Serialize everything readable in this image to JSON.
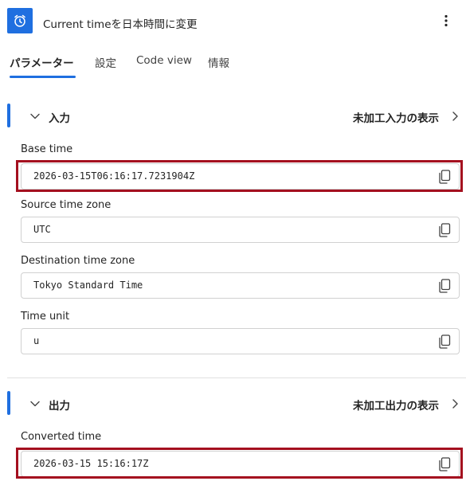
{
  "header": {
    "title": "Current timeを日本時間に変更",
    "icon": "alarm-clock-icon",
    "menu_icon": "more-vertical-icon"
  },
  "tabs": [
    {
      "label": "パラメーター",
      "active": true
    },
    {
      "label": "設定",
      "active": false
    },
    {
      "label": "Code view",
      "active": false
    },
    {
      "label": "情報",
      "active": false
    }
  ],
  "inputs": {
    "section_title": "入力",
    "raw_link": "未加工入力の表示",
    "fields": [
      {
        "label": "Base time",
        "value": "2026-03-15T06:16:17.7231904Z",
        "highlighted": true
      },
      {
        "label": "Source time zone",
        "value": "UTC",
        "highlighted": false
      },
      {
        "label": "Destination time zone",
        "value": "Tokyo Standard Time",
        "highlighted": false
      },
      {
        "label": "Time unit",
        "value": "u",
        "highlighted": false
      }
    ]
  },
  "outputs": {
    "section_title": "出力",
    "raw_link": "未加工出力の表示",
    "fields": [
      {
        "label": "Converted time",
        "value": "2026-03-15 15:16:17Z",
        "highlighted": true
      }
    ]
  },
  "colors": {
    "accent": "#1f6fe0",
    "highlight": "#a4101f",
    "border": "#d1d1d1"
  }
}
